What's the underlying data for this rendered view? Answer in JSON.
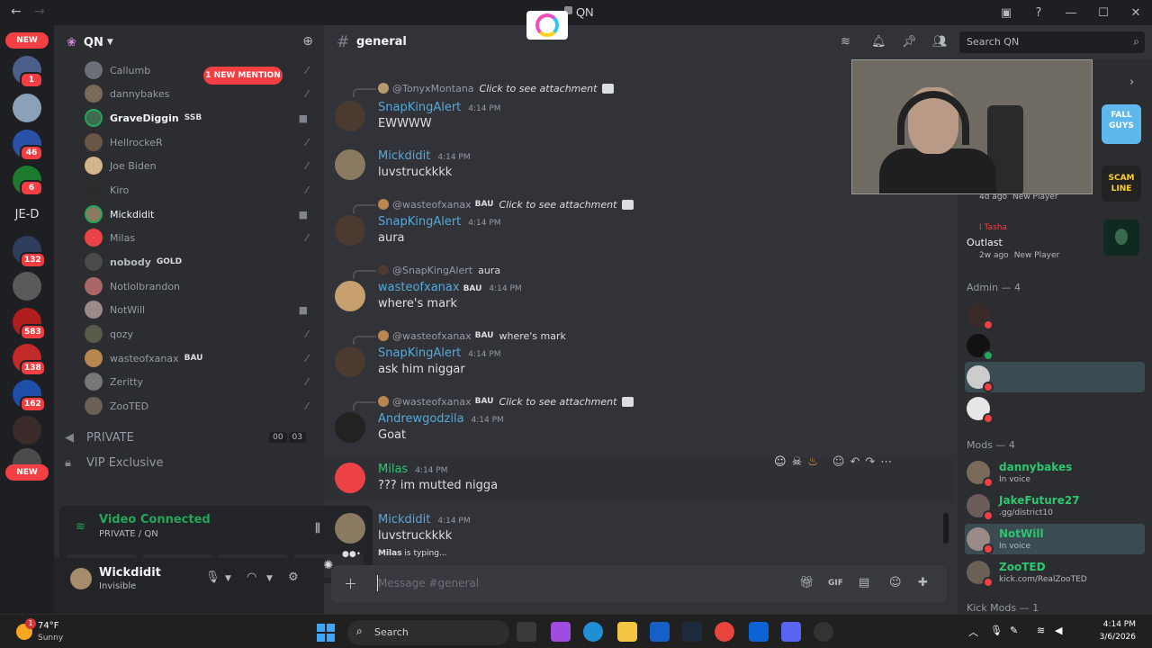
{
  "titlebar": {
    "title": "QN",
    "back_icon": "arrow-left-icon",
    "forward_icon": "arrow-right-icon"
  },
  "rail": {
    "new_top": "NEW",
    "new_bottom": "NEW",
    "jed_text": "JE-D",
    "badges": [
      "1",
      "46",
      "6",
      "132",
      "583",
      "138",
      "162"
    ]
  },
  "server": {
    "name": "QN"
  },
  "voice_members": [
    {
      "name": "Callumb",
      "style": "dim"
    },
    {
      "name": "dannybakes",
      "style": "dim"
    },
    {
      "name": "GraveDiggin",
      "style": "bold",
      "tag": "SSB"
    },
    {
      "name": "HellrockeR",
      "style": "dim"
    },
    {
      "name": "Joe Biden",
      "style": "dim"
    },
    {
      "name": "Kiro",
      "style": "dim"
    },
    {
      "name": "Mickdidit",
      "style": "bright"
    },
    {
      "name": "Milas",
      "style": "dim"
    },
    {
      "name": "nobody",
      "style": "bold",
      "tag": "GOLD"
    },
    {
      "name": "Notlolbrandon",
      "style": "dim"
    },
    {
      "name": "NotWill",
      "style": "dim"
    },
    {
      "name": "qozy",
      "style": "dim"
    },
    {
      "name": "wasteofxanax",
      "style": "dim",
      "tag": "BAU"
    },
    {
      "name": "Zeritty",
      "style": "dim"
    },
    {
      "name": "ZooTED",
      "style": "dim"
    }
  ],
  "mention_pill": "1 NEW MENTION",
  "categories": [
    {
      "label": "PRIVATE",
      "counter": [
        "00",
        "03"
      ]
    },
    {
      "label": "VIP Exclusive"
    }
  ],
  "voice_panel": {
    "title": "Video Connected",
    "subtitle": "PRIVATE / QN"
  },
  "user": {
    "name": "Wickdidit",
    "status": "Invisible"
  },
  "channel": {
    "name": "general"
  },
  "search": {
    "placeholder": "Search QN"
  },
  "messages": [
    {
      "reply_to": "@TonyxMontana",
      "reply_text": "Click to see attachment",
      "author": "SnapKingAlert",
      "time": "4:14 PM",
      "text": "EWWWW"
    },
    {
      "author": "Mickdidit",
      "time": "4:14 PM",
      "text": "luvstruckkkk"
    },
    {
      "reply_to": "@wasteofxanax",
      "reply_badge": "BAU",
      "reply_text": "Click to see attachment",
      "author": "SnapKingAlert",
      "time": "4:14 PM",
      "text": "aura"
    },
    {
      "reply_to": "@SnapKingAlert",
      "reply_text": "aura",
      "author": "wasteofxanax",
      "author_badge": "BAU",
      "time": "4:14 PM",
      "text": "where's mark"
    },
    {
      "reply_to": "@wasteofxanax",
      "reply_badge": "BAU",
      "reply_text": "where's mark",
      "author": "SnapKingAlert",
      "time": "4:14 PM",
      "text": "ask him niggar"
    },
    {
      "reply_to": "@wasteofxanax",
      "reply_badge": "BAU",
      "reply_text": "Click to see attachment",
      "author": "Andrewgodzila",
      "time": "4:14 PM",
      "text": "Goat"
    },
    {
      "author": "Milas",
      "time": "4:14 PM",
      "text": "??? im mutted nigga"
    },
    {
      "author": "Mickdidit",
      "time": "4:14 PM",
      "text": "luvstruckkkk"
    }
  ],
  "typing": {
    "who": "Milas",
    "suffix": " is typing..."
  },
  "composer": {
    "placeholder": "Message #general"
  },
  "right_panel": {
    "activity_top": {
      "ago": "4d ago",
      "status": "New Player"
    },
    "activity_user": "I Tasha",
    "activity_game": "Outlast",
    "activity_ago": "2w ago",
    "activity_status": "New Player",
    "admin_header": "Admin — 4",
    "mods_header": "Mods — 4",
    "kick_mods_header": "Kick Mods — 1",
    "mods": [
      {
        "name": "dannybakes",
        "status": "In voice"
      },
      {
        "name": "JakeFuture27",
        "status": ".gg/district10"
      },
      {
        "name": "NotWill",
        "status": "In voice"
      },
      {
        "name": "ZooTED",
        "status": "kick.com/RealZooTED"
      }
    ],
    "game_tiles": [
      "FALL GUYS",
      "SCAM LINE"
    ]
  },
  "taskbar": {
    "weather_temp": "74°F",
    "weather_desc": "Sunny",
    "weather_badge": "1",
    "search_label": "Search",
    "time": "4:14 PM",
    "date": "3/6/2026"
  },
  "colors": {
    "accent_green": "#23a55a",
    "mention_red": "#f23f43",
    "author_blue": "#56a8d8"
  }
}
